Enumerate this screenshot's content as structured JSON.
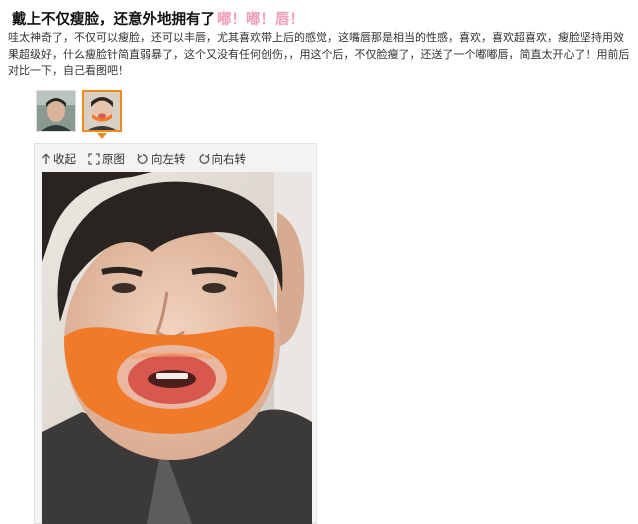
{
  "post": {
    "title": "戴上不仅瘦脸，还意外地拥有了",
    "title_highlight": "嘟！嘟！唇！",
    "body": "哇太神奇了，不仅可以瘦脸，还可以丰唇，尤其喜欢带上后的感觉，这嘴唇那是相当的性感，喜欢，喜欢超喜欢，瘦脸坚持用效果超级好，什么瘦脸针简直弱暴了，这个又没有任何创伤，，用这个后，不仅脸瘦了，还送了一个嘟嘟唇，简直太开心了！用前后对比一下，自己看图吧！"
  },
  "thumbnails": [
    {
      "icon": "photo-thumbnail-before",
      "selected": false
    },
    {
      "icon": "photo-thumbnail-after",
      "selected": true
    }
  ],
  "toolbar": {
    "collapse_label": "收起",
    "original_label": "原图",
    "rotate_left_label": "向左转",
    "rotate_right_label": "向右转"
  },
  "colors": {
    "title_highlight": "#f3a0bb",
    "selected_border": "#f08a1f",
    "mask": "#f07a28",
    "lips": "#d9584e"
  }
}
